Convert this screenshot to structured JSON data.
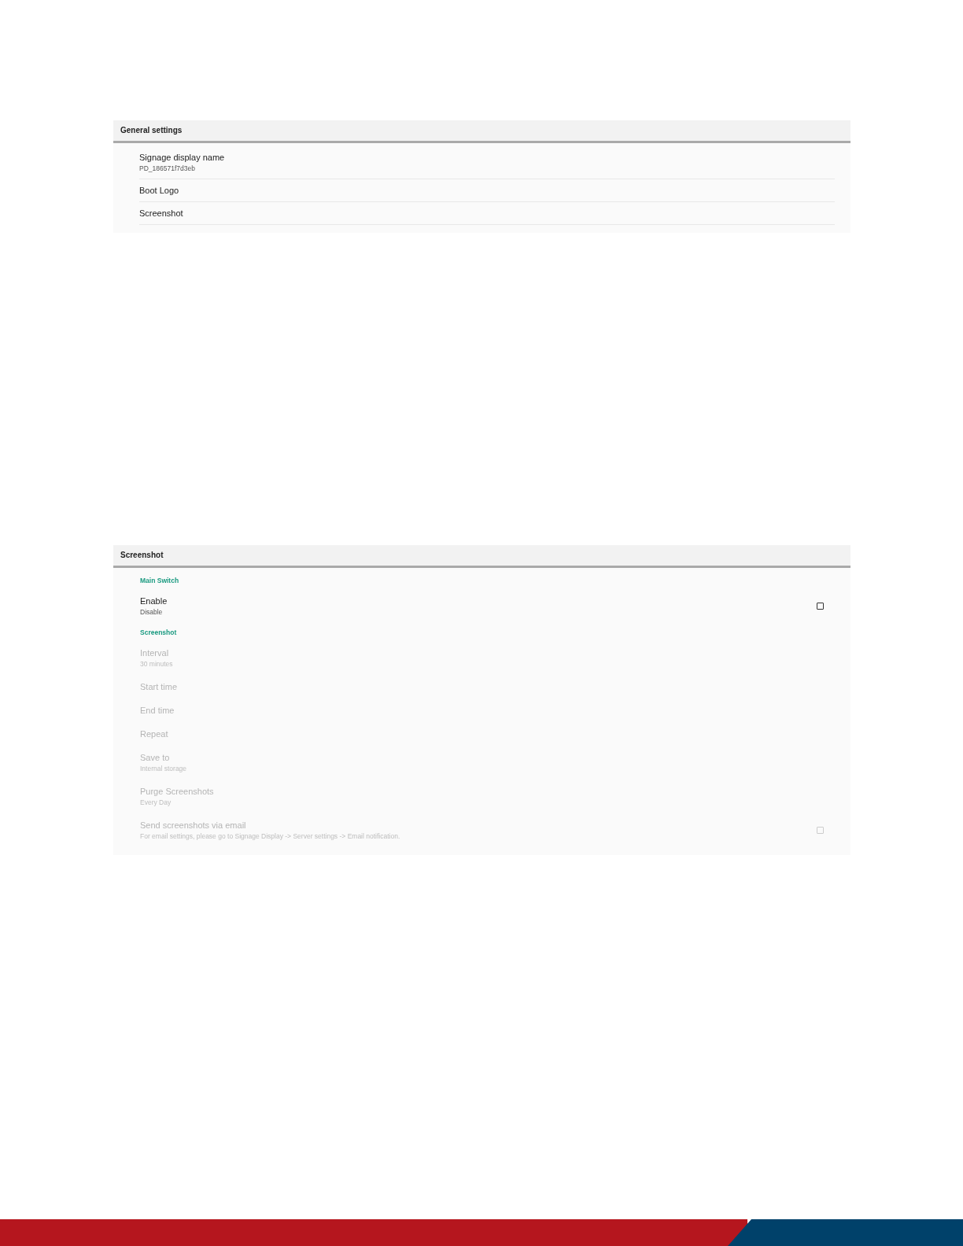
{
  "panels": [
    {
      "title": "General settings",
      "divided": true,
      "rows": [
        {
          "kind": "item",
          "title": "Signage display name",
          "summary": "PD_186571f7d3eb",
          "disabled": false
        },
        {
          "kind": "item",
          "title": "Boot Logo",
          "disabled": false
        },
        {
          "kind": "item",
          "title": "Screenshot",
          "disabled": false
        }
      ]
    },
    {
      "title": "Screenshot",
      "divided": false,
      "rows": [
        {
          "kind": "section",
          "title": "Main Switch"
        },
        {
          "kind": "item",
          "title": "Enable",
          "summary": "Disable",
          "disabled": false,
          "checkbox": {
            "checked": false
          }
        },
        {
          "kind": "section",
          "title": "Screenshot"
        },
        {
          "kind": "item",
          "title": "Interval",
          "summary": "30 minutes",
          "disabled": true
        },
        {
          "kind": "item",
          "title": "Start time",
          "disabled": true
        },
        {
          "kind": "item",
          "title": "End time",
          "disabled": true
        },
        {
          "kind": "item",
          "title": "Repeat",
          "disabled": true
        },
        {
          "kind": "item",
          "title": "Save to",
          "summary": "Internal storage",
          "disabled": true
        },
        {
          "kind": "item",
          "title": "Purge Screenshots",
          "summary": "Every Day",
          "disabled": true
        },
        {
          "kind": "item",
          "title": "Send screenshots via email",
          "summary": "For email settings, please go to Signage Display -> Server settings -> Email notification.",
          "disabled": true,
          "checkbox": {
            "checked": false
          }
        }
      ]
    }
  ]
}
